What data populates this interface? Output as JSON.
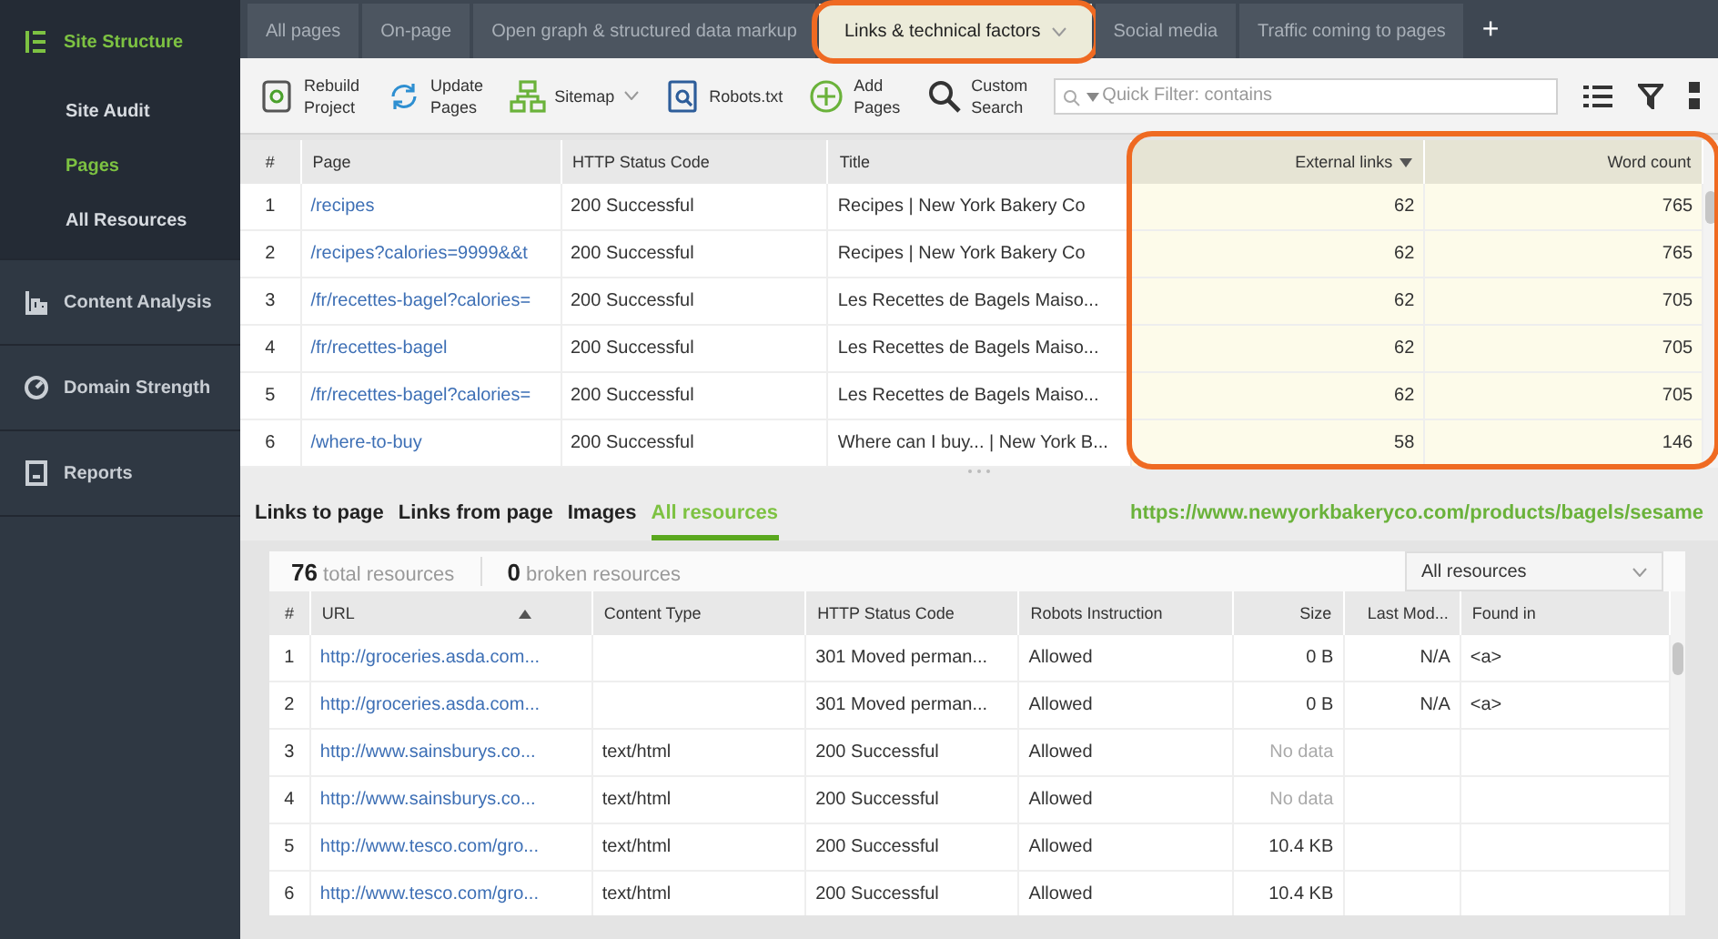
{
  "sidebar": {
    "sections": [
      {
        "label": "Site Structure",
        "selected": true,
        "children": [
          {
            "label": "Site Audit",
            "selected": false
          },
          {
            "label": "Pages",
            "selected": true
          },
          {
            "label": "All Resources",
            "selected": false
          }
        ]
      },
      {
        "label": "Content Analysis",
        "selected": false
      },
      {
        "label": "Domain Strength",
        "selected": false
      },
      {
        "label": "Reports",
        "selected": false
      }
    ]
  },
  "tabs": [
    {
      "label": "All pages",
      "selected": false
    },
    {
      "label": "On-page",
      "selected": false
    },
    {
      "label": "Open graph & structured data markup",
      "selected": false
    },
    {
      "label": "Links & technical factors",
      "selected": true
    },
    {
      "label": "Social media",
      "selected": false
    },
    {
      "label": "Traffic coming to pages",
      "selected": false
    }
  ],
  "add_tab": "+",
  "toolbar": {
    "buttons": [
      {
        "label": "Rebuild Project"
      },
      {
        "label": "Update Pages"
      },
      {
        "label": "Sitemap"
      },
      {
        "label": "Robots.txt"
      },
      {
        "label": "Add Pages"
      },
      {
        "label": "Custom Search"
      }
    ],
    "filter": {
      "placeholder": "Quick Filter: contains"
    }
  },
  "pages_table": {
    "columns": [
      {
        "label": "#"
      },
      {
        "label": "Page"
      },
      {
        "label": "HTTP Status Code"
      },
      {
        "label": "Title"
      },
      {
        "label": "External links",
        "sorted": true
      },
      {
        "label": "Word count"
      }
    ],
    "rows": [
      [
        "1",
        "/recipes",
        "200 Successful",
        "Recipes | New York Bakery Co",
        "62",
        "765"
      ],
      [
        "2",
        "/recipes?calories=9999&&t",
        "200 Successful",
        "Recipes | New York Bakery Co",
        "62",
        "765"
      ],
      [
        "3",
        "/fr/recettes-bagel?calories=",
        "200 Successful",
        "Les Recettes de Bagels Maiso...",
        "62",
        "705"
      ],
      [
        "4",
        "/fr/recettes-bagel",
        "200 Successful",
        "Les Recettes de Bagels Maiso...",
        "62",
        "705"
      ],
      [
        "5",
        "/fr/recettes-bagel?calories=",
        "200 Successful",
        "Les Recettes de Bagels Maiso...",
        "62",
        "705"
      ],
      [
        "6",
        "/where-to-buy",
        "200 Successful",
        "Where can I buy... | New York B...",
        "58",
        "146"
      ]
    ]
  },
  "detail_tabs": [
    {
      "label": "Links to page",
      "selected": false
    },
    {
      "label": "Links from page",
      "selected": false
    },
    {
      "label": "Images",
      "selected": false
    },
    {
      "label": "All resources",
      "selected": true
    }
  ],
  "selected_url": "https://www.newyorkbakeryco.com/products/bagels/sesame",
  "summary": [
    {
      "count": "76",
      "label": "total resources"
    },
    {
      "count": "0",
      "label": "broken resources"
    }
  ],
  "resource_filter": "All resources",
  "resources_table": {
    "columns": [
      {
        "label": "#"
      },
      {
        "label": "URL",
        "sorted": true
      },
      {
        "label": "Content Type"
      },
      {
        "label": "HTTP Status Code"
      },
      {
        "label": "Robots Instruction"
      },
      {
        "label": "Size"
      },
      {
        "label": "Last Mod..."
      },
      {
        "label": "Found in"
      }
    ],
    "rows": [
      [
        "1",
        "http://groceries.asda.com...",
        "",
        "301 Moved perman...",
        "Allowed",
        "0 B",
        "N/A",
        "<a>"
      ],
      [
        "2",
        "http://groceries.asda.com...",
        "",
        "301 Moved perman...",
        "Allowed",
        "0 B",
        "N/A",
        "<a>"
      ],
      [
        "3",
        "http://www.sainsburys.co...",
        "text/html",
        "200 Successful",
        "Allowed",
        "No data",
        "",
        ""
      ],
      [
        "4",
        "http://www.sainsburys.co...",
        "text/html",
        "200 Successful",
        "Allowed",
        "No data",
        "",
        ""
      ],
      [
        "5",
        "http://www.tesco.com/gro...",
        "text/html",
        "200 Successful",
        "Allowed",
        "10.4 KB",
        "",
        ""
      ],
      [
        "6",
        "http://www.tesco.com/gro...",
        "text/html",
        "200 Successful",
        "Allowed",
        "10.4 KB",
        "",
        ""
      ]
    ]
  }
}
